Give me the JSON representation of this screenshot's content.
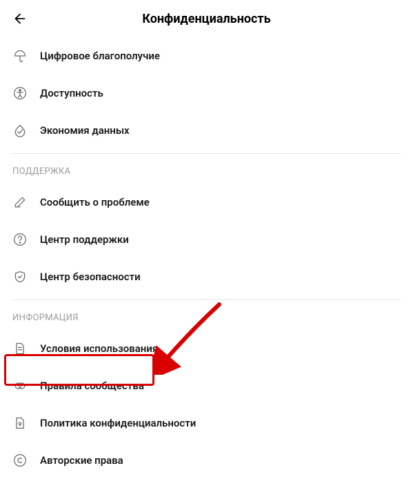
{
  "header": {
    "title": "Конфиденциальность"
  },
  "top_items": [
    {
      "label": "Цифровое благополучие",
      "icon": "umbrella"
    },
    {
      "label": "Доступность",
      "icon": "accessibility"
    },
    {
      "label": "Экономия данных",
      "icon": "data-saver"
    }
  ],
  "sections": [
    {
      "title": "ПОДДЕРЖКА",
      "items": [
        {
          "label": "Сообщить о проблеме",
          "icon": "pencil"
        },
        {
          "label": "Центр поддержки",
          "icon": "help"
        },
        {
          "label": "Центр безопасности",
          "icon": "shield"
        }
      ]
    },
    {
      "title": "ИНФОРМАЦИЯ",
      "items": [
        {
          "label": "Условия использования",
          "icon": "document"
        },
        {
          "label": "Правила сообщества",
          "icon": "rules"
        },
        {
          "label": "Политика конфиденциальности",
          "icon": "privacy"
        },
        {
          "label": "Авторские права",
          "icon": "copyright"
        }
      ]
    }
  ]
}
